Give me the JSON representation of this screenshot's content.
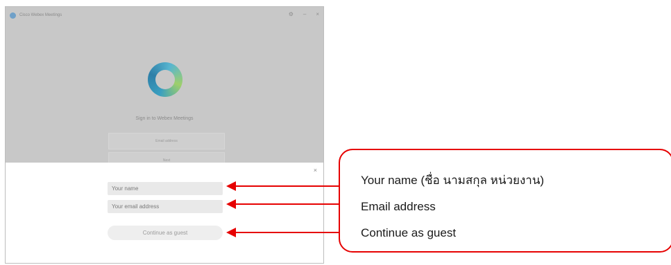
{
  "window": {
    "title": "Cisco Webex Meetings",
    "signin_heading": "Sign in to Webex Meetings",
    "bg_email_field": "Email address",
    "bg_next_button": "Next"
  },
  "dialog": {
    "close_label": "×",
    "name_placeholder": "Your name",
    "email_placeholder": "Your email address",
    "continue_label": "Continue as guest"
  },
  "callouts": [
    "Your name (ชื่อ นามสกุล หน่วยงาน)",
    "Email address",
    "Continue as guest"
  ],
  "colors": {
    "accent": "#e60000",
    "overlay": "#c8c8c8"
  },
  "icons": {
    "app_logo": "webex-logo-icon",
    "close": "close-icon",
    "arrow": "arrow-left-icon"
  }
}
